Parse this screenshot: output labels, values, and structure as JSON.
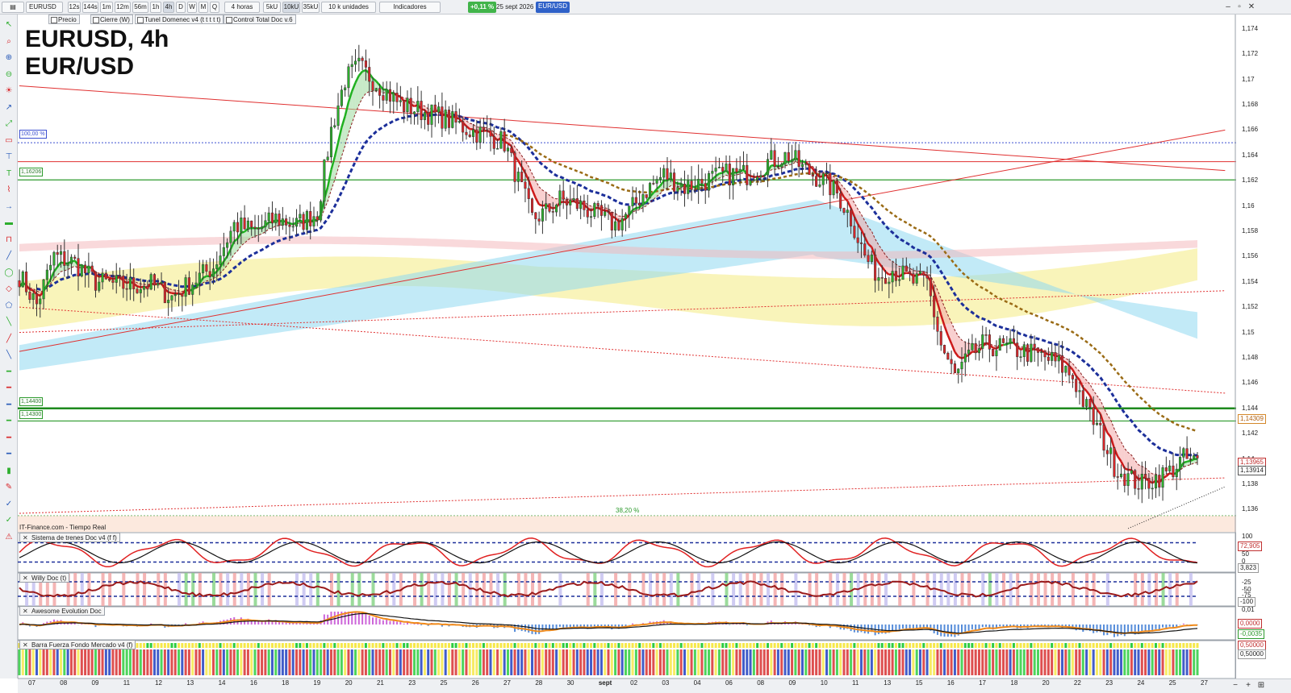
{
  "toolbar": {
    "symbol": "EURUSD",
    "timeframes": [
      "12s",
      "144s",
      "1m",
      "12m",
      "56m",
      "1h",
      "4h",
      "D",
      "W",
      "M",
      "Q"
    ],
    "active_timeframe": "4h",
    "period_select": "4 horas",
    "volumes": [
      "5kU",
      "10kU",
      "35kU"
    ],
    "active_volume": "10kU",
    "units_select": "10 k unidades",
    "indicators_label": "Indicadores",
    "change_pct": "+0,11 %",
    "date": "25 sept 2026",
    "instrument": "EUR/USD"
  },
  "overlays": [
    "Precio",
    "Cierre (W)",
    "Tunel Domenec v4 (t t t t t)",
    "Control Total Doc v.6"
  ],
  "chart_title": {
    "line1": "EURUSD, 4h",
    "line2": "EUR/USD"
  },
  "level_tags": {
    "pct100": "100,00 %",
    "l1": "1,16206",
    "l2": "1,14400",
    "l3": "1,14300",
    "pct38": "38,20 %"
  },
  "price_tags": {
    "last1": "1,14309",
    "last2": "1,13965",
    "last3": "1,13914"
  },
  "feed_label": "IT-Finance.com - Tiempo Real",
  "panels": {
    "p1": {
      "label": "Sistema de trenes Doc v4 (f f)",
      "ticks": [
        "100",
        "72,905",
        "50",
        "0",
        "3,823"
      ]
    },
    "p2": {
      "label": "Willy Doc (t)",
      "ticks": [
        "-25",
        "-50",
        "-75",
        "-100"
      ]
    },
    "p3": {
      "label": "Awesome Evolution Doc",
      "ticks": [
        "0,01",
        "0,0000",
        "-0,0035"
      ]
    },
    "p4": {
      "label": "Barra Fuerza Fondo Mercado v4 (f)",
      "ticks": [
        "0,50000",
        "0,50000"
      ]
    }
  },
  "colors": {
    "up": "#2dae2d",
    "down": "#d8262a",
    "ema_fast": "#20b020",
    "ema_slow": "#1c2f9a",
    "trend_brown": "#9a6b15",
    "cloud_blue": "#8fd9f0",
    "cloud_yellow": "#f7ef9c"
  },
  "chart_data": {
    "type": "candlestick",
    "title": "EURUSD, 4h",
    "subtitle": "EUR/USD",
    "ylim": [
      1.135,
      1.1745
    ],
    "yticks": [
      1.174,
      1.172,
      1.17,
      1.168,
      1.166,
      1.164,
      1.162,
      1.16,
      1.158,
      1.156,
      1.154,
      1.152,
      1.15,
      1.148,
      1.146,
      1.144,
      1.142,
      1.14,
      1.138,
      1.136
    ],
    "ytick_labels": [
      "1,174",
      "1,172",
      "1,17",
      "1,168",
      "1,166",
      "1,164",
      "1,162",
      "1,16",
      "1,158",
      "1,156",
      "1,154",
      "1,152",
      "1,15",
      "1,148",
      "1,146",
      "1,144",
      "1,142",
      "1,14",
      "1,138",
      "1,136"
    ],
    "x_labels": [
      "07",
      "08",
      "09",
      "11",
      "12",
      "13",
      "14",
      "16",
      "18",
      "19",
      "20",
      "21",
      "23",
      "25",
      "26",
      "27",
      "28",
      "30",
      "sept",
      "02",
      "03",
      "04",
      "06",
      "08",
      "09",
      "10",
      "11",
      "13",
      "15",
      "16",
      "17",
      "18",
      "20",
      "22",
      "23",
      "24",
      "25",
      "27"
    ],
    "close_path": [
      [
        0,
        1.1545
      ],
      [
        5,
        1.1522
      ],
      [
        10,
        1.156
      ],
      [
        16,
        1.1555
      ],
      [
        22,
        1.154
      ],
      [
        30,
        1.1537
      ],
      [
        38,
        1.1538
      ],
      [
        44,
        1.1528
      ],
      [
        50,
        1.154
      ],
      [
        56,
        1.1552
      ],
      [
        62,
        1.1585
      ],
      [
        68,
        1.158
      ],
      [
        74,
        1.159
      ],
      [
        80,
        1.1585
      ],
      [
        86,
        1.1595
      ],
      [
        90,
        1.166
      ],
      [
        94,
        1.17
      ],
      [
        98,
        1.171
      ],
      [
        104,
        1.1695
      ],
      [
        110,
        1.168
      ],
      [
        116,
        1.1675
      ],
      [
        122,
        1.167
      ],
      [
        126,
        1.1665
      ],
      [
        130,
        1.166
      ],
      [
        136,
        1.1655
      ],
      [
        140,
        1.165
      ],
      [
        144,
        1.162
      ],
      [
        148,
        1.159
      ],
      [
        152,
        1.1595
      ],
      [
        156,
        1.1605
      ],
      [
        162,
        1.16
      ],
      [
        168,
        1.159
      ],
      [
        172,
        1.1585
      ],
      [
        176,
        1.1595
      ],
      [
        180,
        1.161
      ],
      [
        186,
        1.1625
      ],
      [
        192,
        1.1615
      ],
      [
        198,
        1.162
      ],
      [
        204,
        1.1625
      ],
      [
        210,
        1.1625
      ],
      [
        216,
        1.1635
      ],
      [
        222,
        1.164
      ],
      [
        226,
        1.163
      ],
      [
        232,
        1.162
      ],
      [
        236,
        1.161
      ],
      [
        240,
        1.159
      ],
      [
        244,
        1.156
      ],
      [
        248,
        1.1545
      ],
      [
        252,
        1.155
      ],
      [
        258,
        1.154
      ],
      [
        262,
        1.154
      ],
      [
        266,
        1.149
      ],
      [
        270,
        1.1465
      ],
      [
        274,
        1.148
      ],
      [
        278,
        1.149
      ],
      [
        284,
        1.1488
      ],
      [
        290,
        1.1485
      ],
      [
        296,
        1.148
      ],
      [
        300,
        1.1475
      ],
      [
        304,
        1.1465
      ],
      [
        308,
        1.144
      ],
      [
        312,
        1.142
      ],
      [
        316,
        1.1395
      ],
      [
        320,
        1.1385
      ],
      [
        324,
        1.138
      ],
      [
        328,
        1.1385
      ],
      [
        332,
        1.139
      ],
      [
        336,
        1.14
      ],
      [
        340,
        1.1397
      ]
    ],
    "levels": [
      1.16206,
      1.144,
      1.143
    ]
  }
}
